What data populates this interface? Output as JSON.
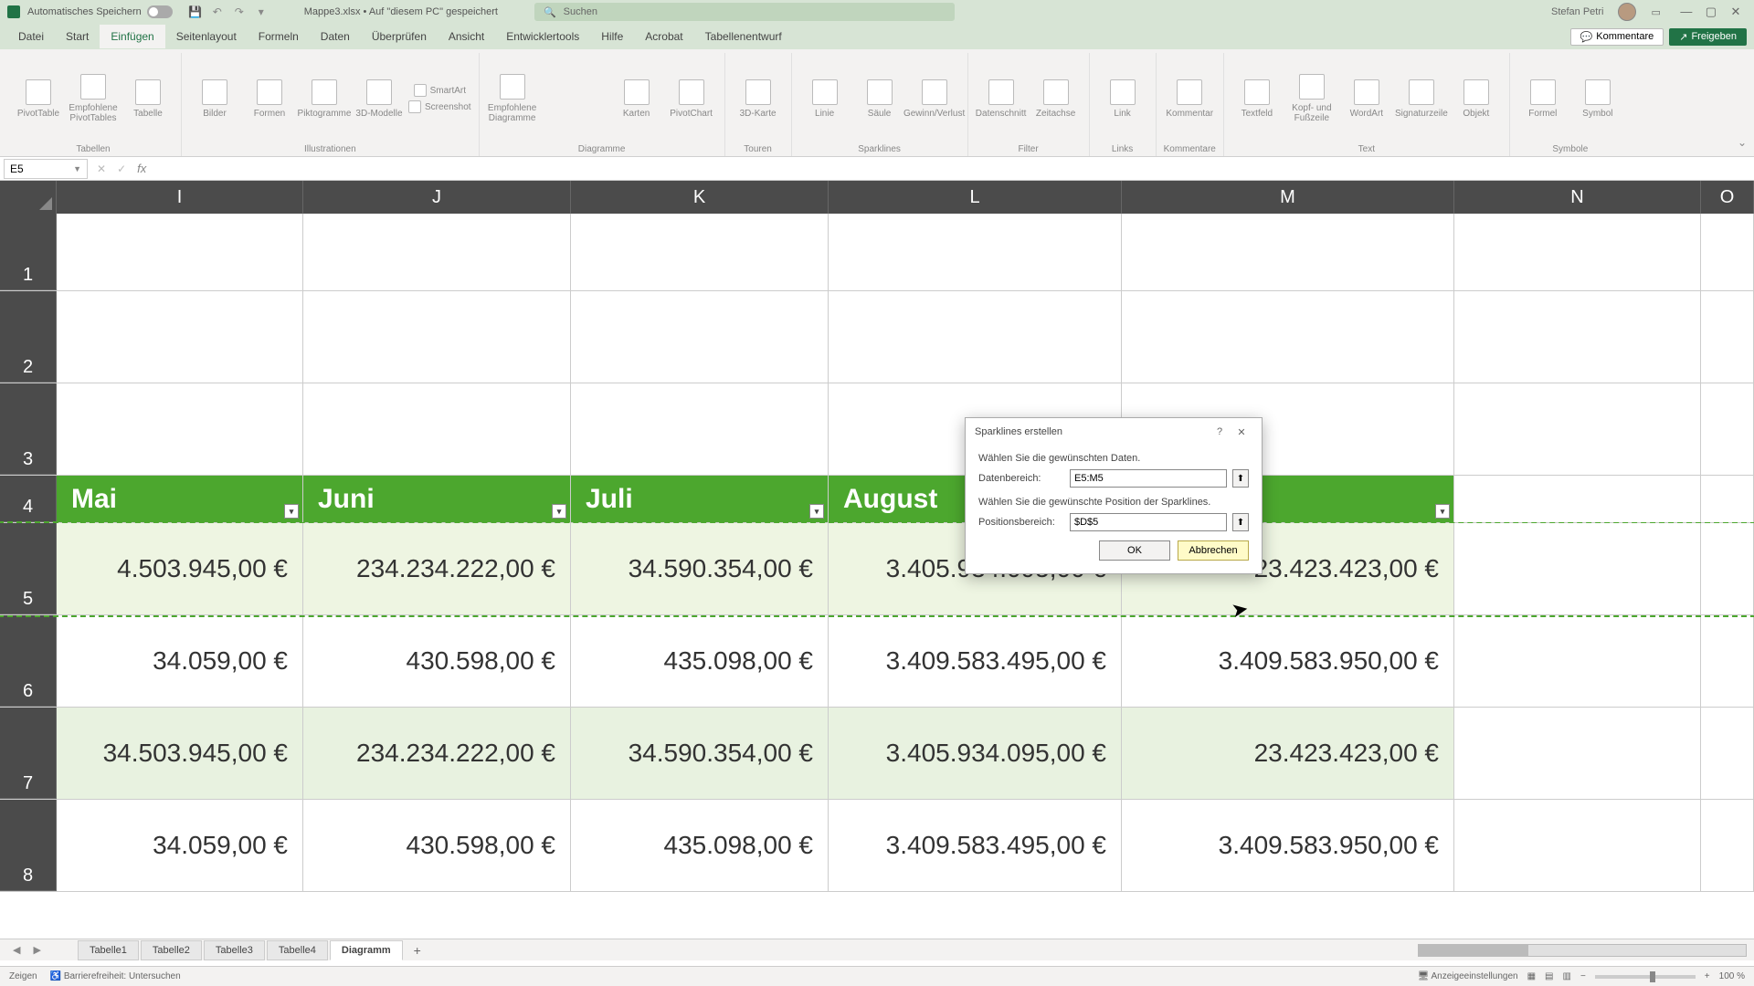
{
  "title": {
    "autosave_label": "Automatisches Speichern",
    "doc": "Mappe3.xlsx • Auf \"diesem PC\" gespeichert",
    "search_placeholder": "Suchen",
    "user": "Stefan Petri"
  },
  "tabs": {
    "items": [
      "Datei",
      "Start",
      "Einfügen",
      "Seitenlayout",
      "Formeln",
      "Daten",
      "Überprüfen",
      "Ansicht",
      "Entwicklertools",
      "Hilfe",
      "Acrobat",
      "Tabellenentwurf"
    ],
    "active_index": 2,
    "comments": "Kommentare",
    "share": "Freigeben"
  },
  "ribbon": {
    "groups": [
      {
        "label": "Tabellen",
        "items": [
          "PivotTable",
          "Empfohlene PivotTables",
          "Tabelle"
        ]
      },
      {
        "label": "Illustrationen",
        "items": [
          "Bilder",
          "Formen",
          "Piktogramme",
          "3D-Modelle"
        ],
        "extras": [
          "SmartArt",
          "Screenshot"
        ]
      },
      {
        "label": "Diagramme",
        "items": [
          "Empfohlene Diagramme"
        ],
        "extras": [
          "Karten",
          "PivotChart"
        ]
      },
      {
        "label": "Touren",
        "items": [
          "3D-Karte"
        ]
      },
      {
        "label": "Sparklines",
        "items": [
          "Linie",
          "Säule",
          "Gewinn/Verlust"
        ]
      },
      {
        "label": "Filter",
        "items": [
          "Datenschnitt",
          "Zeitachse"
        ]
      },
      {
        "label": "Links",
        "items": [
          "Link"
        ]
      },
      {
        "label": "Kommentare",
        "items": [
          "Kommentar"
        ]
      },
      {
        "label": "Text",
        "items": [
          "Textfeld",
          "Kopf- und Fußzeile",
          "WordArt",
          "Signaturzeile",
          "Objekt"
        ]
      },
      {
        "label": "Symbole",
        "items": [
          "Formel",
          "Symbol"
        ]
      }
    ]
  },
  "namebox": "E5",
  "columns": [
    "I",
    "J",
    "K",
    "L",
    "M",
    "N",
    "O"
  ],
  "rownums": [
    "1",
    "2",
    "3",
    "4",
    "5",
    "6",
    "7",
    "8"
  ],
  "header_row": [
    "Mai",
    "Juni",
    "Juli",
    "August",
    "",
    ""
  ],
  "data": {
    "r5": [
      "4.503.945,00 €",
      "234.234.222,00 €",
      "34.590.354,00 €",
      "3.405.934.095,00 €",
      "23.423.423,00 €",
      ""
    ],
    "r6": [
      "34.059,00 €",
      "430.598,00 €",
      "435.098,00 €",
      "3.409.583.495,00 €",
      "3.409.583.950,00 €",
      ""
    ],
    "r7": [
      "34.503.945,00 €",
      "234.234.222,00 €",
      "34.590.354,00 €",
      "3.405.934.095,00 €",
      "23.423.423,00 €",
      ""
    ],
    "r8": [
      "34.059,00 €",
      "430.598,00 €",
      "435.098,00 €",
      "3.409.583.495,00 €",
      "3.409.583.950,00 €",
      ""
    ]
  },
  "sheets": {
    "items": [
      "Tabelle1",
      "Tabelle2",
      "Tabelle3",
      "Tabelle4",
      "Diagramm"
    ],
    "active_index": 4
  },
  "status": {
    "mode": "Zeigen",
    "access": "Barrierefreiheit: Untersuchen",
    "views": "Anzeigeeinstellungen",
    "zoom": "100 %"
  },
  "dialog": {
    "title": "Sparklines erstellen",
    "instr1": "Wählen Sie die gewünschten Daten.",
    "range_label": "Datenbereich:",
    "range_value": "E5:M5",
    "instr2": "Wählen Sie die gewünschte Position der Sparklines.",
    "pos_label": "Positionsbereich:",
    "pos_value": "$D$5",
    "ok": "OK",
    "cancel": "Abbrechen"
  }
}
